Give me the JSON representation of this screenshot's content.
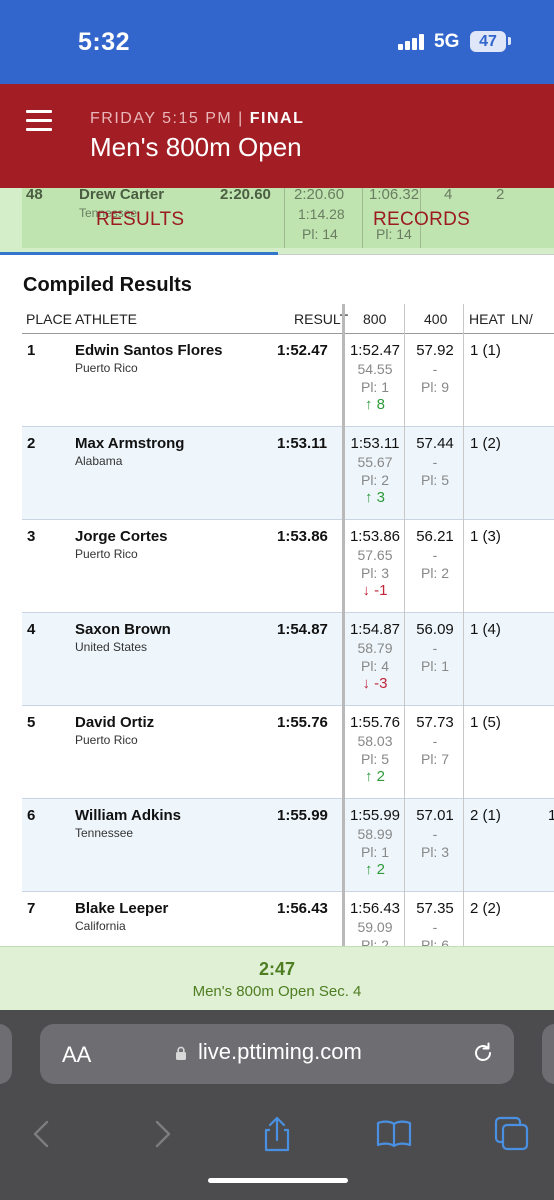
{
  "status_bar": {
    "time": "5:32",
    "network": "5G",
    "battery": "47"
  },
  "header": {
    "subtitle_prefix": "FRIDAY 5:15 PM | ",
    "subtitle_status": "FINAL",
    "title": "Men's 800m Open"
  },
  "peek_row": {
    "place": "48",
    "athlete": "Drew Carter",
    "team": "Tennessee",
    "result": "2:20.60",
    "split_800": "2:20.60",
    "split_800_sub": "1:14.28",
    "split_800_pl": "Pl: 14",
    "split_400": "1:06.32",
    "split_400_pl": "Pl: 14",
    "heat": "4",
    "lane": "2"
  },
  "tabs": [
    {
      "label": "RESULTS"
    },
    {
      "label": "RECORDS"
    }
  ],
  "section_title": "Compiled Results",
  "columns": {
    "place": "PLACE",
    "athlete": "ATHLETE",
    "result": "RESULT",
    "split1": "800",
    "split2": "400",
    "heat": "HEAT",
    "lane": "LN/"
  },
  "rows": [
    {
      "place": "1",
      "athlete": "Edwin Santos Flores",
      "team": "Puerto Rico",
      "result": "1:52.47",
      "s800": "1:52.47",
      "s800_sub": "54.55",
      "s800_pl": "Pl: 1",
      "change": "↑ 8",
      "change_dir": "up",
      "s400": "57.92",
      "s400_sub": "-",
      "s400_pl": "Pl: 9",
      "heat": "1 (1)",
      "lane": ""
    },
    {
      "place": "2",
      "athlete": "Max Armstrong",
      "team": "Alabama",
      "result": "1:53.11",
      "s800": "1:53.11",
      "s800_sub": "55.67",
      "s800_pl": "Pl: 2",
      "change": "↑ 3",
      "change_dir": "up",
      "s400": "57.44",
      "s400_sub": "-",
      "s400_pl": "Pl: 5",
      "heat": "1 (2)",
      "lane": ""
    },
    {
      "place": "3",
      "athlete": "Jorge Cortes",
      "team": "Puerto Rico",
      "result": "1:53.86",
      "s800": "1:53.86",
      "s800_sub": "57.65",
      "s800_pl": "Pl: 3",
      "change": "↓ -1",
      "change_dir": "down",
      "s400": "56.21",
      "s400_sub": "-",
      "s400_pl": "Pl: 2",
      "heat": "1 (3)",
      "lane": ""
    },
    {
      "place": "4",
      "athlete": "Saxon Brown",
      "team": "United States",
      "result": "1:54.87",
      "s800": "1:54.87",
      "s800_sub": "58.79",
      "s800_pl": "Pl: 4",
      "change": "↓ -3",
      "change_dir": "down",
      "s400": "56.09",
      "s400_sub": "-",
      "s400_pl": "Pl: 1",
      "heat": "1 (4)",
      "lane": ""
    },
    {
      "place": "5",
      "athlete": "David Ortiz",
      "team": "Puerto Rico",
      "result": "1:55.76",
      "s800": "1:55.76",
      "s800_sub": "58.03",
      "s800_pl": "Pl: 5",
      "change": "↑ 2",
      "change_dir": "up",
      "s400": "57.73",
      "s400_sub": "-",
      "s400_pl": "Pl: 7",
      "heat": "1 (5)",
      "lane": ""
    },
    {
      "place": "6",
      "athlete": "William Adkins",
      "team": "Tennessee",
      "result": "1:55.99",
      "s800": "1:55.99",
      "s800_sub": "58.99",
      "s800_pl": "Pl: 1",
      "change": "↑ 2",
      "change_dir": "up",
      "s400": "57.01",
      "s400_sub": "-",
      "s400_pl": "Pl: 3",
      "heat": "2 (1)",
      "lane": "1"
    },
    {
      "place": "7",
      "athlete": "Blake Leeper",
      "team": "California",
      "result": "1:56.43",
      "s800": "1:56.43",
      "s800_sub": "59.09",
      "s800_pl": "Pl: 2",
      "change": "",
      "change_dir": "up",
      "s400": "57.35",
      "s400_sub": "-",
      "s400_pl": "Pl: 6",
      "heat": "2 (2)",
      "lane": ""
    }
  ],
  "banner": {
    "time": "2:47",
    "label": "Men's 800m Open Sec. 4"
  },
  "browser": {
    "aa_label": "AA",
    "url": "live.pttiming.com"
  },
  "colors": {
    "status_blue": "#3366cc",
    "header_red": "#a21e24",
    "up_green": "#2e9a3a",
    "down_red": "#c0253a",
    "banner_green": "#4f7d22"
  }
}
